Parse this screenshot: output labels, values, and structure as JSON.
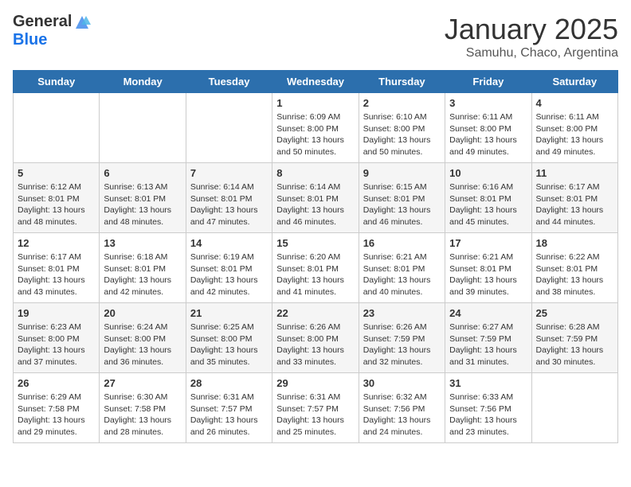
{
  "logo": {
    "general": "General",
    "blue": "Blue"
  },
  "title": "January 2025",
  "subtitle": "Samuhu, Chaco, Argentina",
  "days_of_week": [
    "Sunday",
    "Monday",
    "Tuesday",
    "Wednesday",
    "Thursday",
    "Friday",
    "Saturday"
  ],
  "weeks": [
    [
      {
        "num": "",
        "detail": ""
      },
      {
        "num": "",
        "detail": ""
      },
      {
        "num": "",
        "detail": ""
      },
      {
        "num": "1",
        "detail": "Sunrise: 6:09 AM\nSunset: 8:00 PM\nDaylight: 13 hours\nand 50 minutes."
      },
      {
        "num": "2",
        "detail": "Sunrise: 6:10 AM\nSunset: 8:00 PM\nDaylight: 13 hours\nand 50 minutes."
      },
      {
        "num": "3",
        "detail": "Sunrise: 6:11 AM\nSunset: 8:00 PM\nDaylight: 13 hours\nand 49 minutes."
      },
      {
        "num": "4",
        "detail": "Sunrise: 6:11 AM\nSunset: 8:00 PM\nDaylight: 13 hours\nand 49 minutes."
      }
    ],
    [
      {
        "num": "5",
        "detail": "Sunrise: 6:12 AM\nSunset: 8:01 PM\nDaylight: 13 hours\nand 48 minutes."
      },
      {
        "num": "6",
        "detail": "Sunrise: 6:13 AM\nSunset: 8:01 PM\nDaylight: 13 hours\nand 48 minutes."
      },
      {
        "num": "7",
        "detail": "Sunrise: 6:14 AM\nSunset: 8:01 PM\nDaylight: 13 hours\nand 47 minutes."
      },
      {
        "num": "8",
        "detail": "Sunrise: 6:14 AM\nSunset: 8:01 PM\nDaylight: 13 hours\nand 46 minutes."
      },
      {
        "num": "9",
        "detail": "Sunrise: 6:15 AM\nSunset: 8:01 PM\nDaylight: 13 hours\nand 46 minutes."
      },
      {
        "num": "10",
        "detail": "Sunrise: 6:16 AM\nSunset: 8:01 PM\nDaylight: 13 hours\nand 45 minutes."
      },
      {
        "num": "11",
        "detail": "Sunrise: 6:17 AM\nSunset: 8:01 PM\nDaylight: 13 hours\nand 44 minutes."
      }
    ],
    [
      {
        "num": "12",
        "detail": "Sunrise: 6:17 AM\nSunset: 8:01 PM\nDaylight: 13 hours\nand 43 minutes."
      },
      {
        "num": "13",
        "detail": "Sunrise: 6:18 AM\nSunset: 8:01 PM\nDaylight: 13 hours\nand 42 minutes."
      },
      {
        "num": "14",
        "detail": "Sunrise: 6:19 AM\nSunset: 8:01 PM\nDaylight: 13 hours\nand 42 minutes."
      },
      {
        "num": "15",
        "detail": "Sunrise: 6:20 AM\nSunset: 8:01 PM\nDaylight: 13 hours\nand 41 minutes."
      },
      {
        "num": "16",
        "detail": "Sunrise: 6:21 AM\nSunset: 8:01 PM\nDaylight: 13 hours\nand 40 minutes."
      },
      {
        "num": "17",
        "detail": "Sunrise: 6:21 AM\nSunset: 8:01 PM\nDaylight: 13 hours\nand 39 minutes."
      },
      {
        "num": "18",
        "detail": "Sunrise: 6:22 AM\nSunset: 8:01 PM\nDaylight: 13 hours\nand 38 minutes."
      }
    ],
    [
      {
        "num": "19",
        "detail": "Sunrise: 6:23 AM\nSunset: 8:00 PM\nDaylight: 13 hours\nand 37 minutes."
      },
      {
        "num": "20",
        "detail": "Sunrise: 6:24 AM\nSunset: 8:00 PM\nDaylight: 13 hours\nand 36 minutes."
      },
      {
        "num": "21",
        "detail": "Sunrise: 6:25 AM\nSunset: 8:00 PM\nDaylight: 13 hours\nand 35 minutes."
      },
      {
        "num": "22",
        "detail": "Sunrise: 6:26 AM\nSunset: 8:00 PM\nDaylight: 13 hours\nand 33 minutes."
      },
      {
        "num": "23",
        "detail": "Sunrise: 6:26 AM\nSunset: 7:59 PM\nDaylight: 13 hours\nand 32 minutes."
      },
      {
        "num": "24",
        "detail": "Sunrise: 6:27 AM\nSunset: 7:59 PM\nDaylight: 13 hours\nand 31 minutes."
      },
      {
        "num": "25",
        "detail": "Sunrise: 6:28 AM\nSunset: 7:59 PM\nDaylight: 13 hours\nand 30 minutes."
      }
    ],
    [
      {
        "num": "26",
        "detail": "Sunrise: 6:29 AM\nSunset: 7:58 PM\nDaylight: 13 hours\nand 29 minutes."
      },
      {
        "num": "27",
        "detail": "Sunrise: 6:30 AM\nSunset: 7:58 PM\nDaylight: 13 hours\nand 28 minutes."
      },
      {
        "num": "28",
        "detail": "Sunrise: 6:31 AM\nSunset: 7:57 PM\nDaylight: 13 hours\nand 26 minutes."
      },
      {
        "num": "29",
        "detail": "Sunrise: 6:31 AM\nSunset: 7:57 PM\nDaylight: 13 hours\nand 25 minutes."
      },
      {
        "num": "30",
        "detail": "Sunrise: 6:32 AM\nSunset: 7:56 PM\nDaylight: 13 hours\nand 24 minutes."
      },
      {
        "num": "31",
        "detail": "Sunrise: 6:33 AM\nSunset: 7:56 PM\nDaylight: 13 hours\nand 23 minutes."
      },
      {
        "num": "",
        "detail": ""
      }
    ]
  ]
}
